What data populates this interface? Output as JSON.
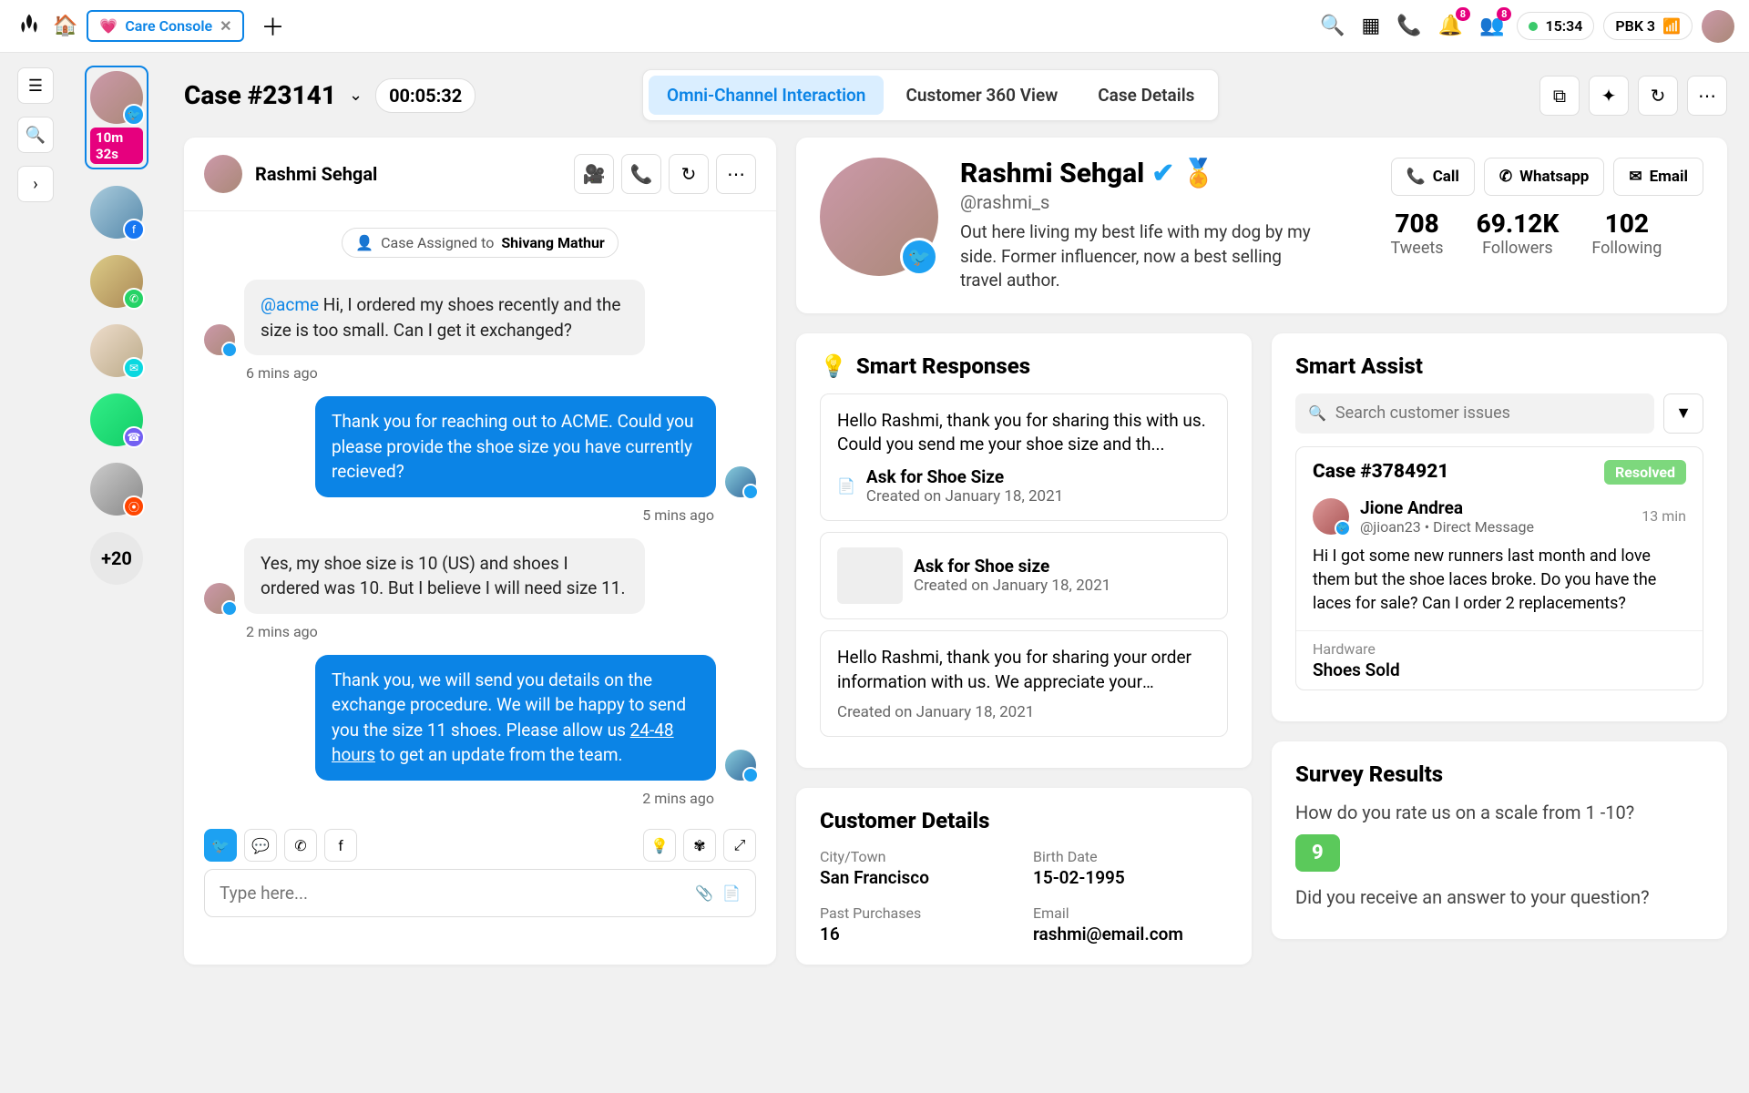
{
  "top": {
    "tab_label": "Care Console",
    "time": "15:34",
    "network": "PBK 3",
    "notif_count": "8",
    "group_count": "8"
  },
  "rail_more": "+20",
  "queue": {
    "active_time": "10m 32s"
  },
  "case": {
    "title": "Case #23141",
    "timer": "00:05:32"
  },
  "tabs": {
    "t1": "Omni-Channel Interaction",
    "t2": "Customer 360 View",
    "t3": "Case Details"
  },
  "chat": {
    "name": "Rashmi Sehgal",
    "assigned_prefix": "Case Assigned to ",
    "assigned_to": "Shivang Mathur",
    "m1_mention": "@acme",
    "m1": " Hi, I ordered my shoes recently and the size is too small. Can I get it exchanged?",
    "m1_time": "6 mins ago",
    "m2": "Thank you for reaching out to ACME. Could you please provide the shoe size you have currently recieved?",
    "m2_time": "5 mins ago",
    "m3": "Yes, my shoe size is 10 (US) and shoes I ordered was 10. But I believe I will need size 11.",
    "m3_time": "2 mins ago",
    "m4_a": "Thank you, we will send you details on the exchange procedure. We will be happy to send you the size 11 shoes. Please allow us ",
    "m4_u": "24-48 hours",
    "m4_b": " to get an update from the team.",
    "m4_time": "2 mins ago",
    "placeholder": "Type here..."
  },
  "profile": {
    "name": "Rashmi Sehgal",
    "handle": "@rashmi_s",
    "bio": "Out here living my best life with my dog by my side. Former influencer, now a best selling travel author.",
    "call": "Call",
    "whatsapp": "Whatsapp",
    "email": "Email",
    "tweets_n": "708",
    "tweets_l": "Tweets",
    "followers_n": "69.12K",
    "followers_l": "Followers",
    "following_n": "102",
    "following_l": "Following"
  },
  "smart_responses": {
    "title": "Smart Responses",
    "r1_txt": "Hello Rashmi, thank you for sharing this with us. Could you send me your shoe size and th...",
    "r1_title": "Ask for Shoe Size",
    "r1_sub": "Created on January 18, 2021",
    "r2_title": "Ask for Shoe size",
    "r2_sub": "Created on January 18, 2021",
    "r3_txt": "Hello Rashmi, thank you for sharing your order information with us. We appreciate your patience. I hope we were able to solve your...",
    "r3_sub": "Created on January 18, 2021"
  },
  "customer_details": {
    "title": "Customer Details",
    "city_l": "City/Town",
    "city_v": "San Francisco",
    "birth_l": "Birth Date",
    "birth_v": "15-02-1995",
    "purch_l": "Past Purchases",
    "purch_v": "16",
    "email_l": "Email",
    "email_v": "rashmi@email.com"
  },
  "smart_assist": {
    "title": "Smart Assist",
    "search_ph": "Search customer issues",
    "case_id": "Case #3784921",
    "status": "Resolved",
    "user": "Jione Andrea",
    "handle": "@jioan23 • Direct Message",
    "time": "13 min",
    "msg": "Hi I got some new runners last month and love them but the shoe laces broke. Do you have the laces for sale? Can I order 2 replacements?",
    "cat": "Hardware",
    "item": "Shoes Sold"
  },
  "survey": {
    "title": "Survey Results",
    "q1": "How do you rate us on a scale from 1 -10?",
    "a1": "9",
    "q2": "Did you receive an answer to your question?"
  }
}
